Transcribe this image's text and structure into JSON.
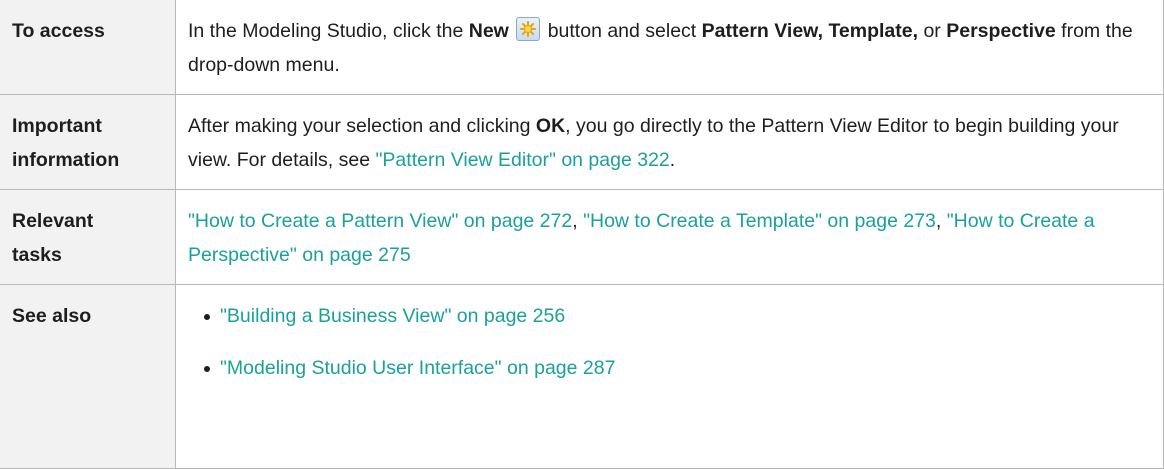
{
  "rows": {
    "access": {
      "label": "To access",
      "t1": "In the Modeling Studio, click the ",
      "b1": "New",
      "t2": " button and select ",
      "b2": "Pattern View, Template,",
      "t3": " or ",
      "b3": "Perspective",
      "t4": " from the drop-down menu."
    },
    "important": {
      "label1": "Important",
      "label2": "information",
      "t1": "After making your selection and clicking ",
      "b1": "OK",
      "t2": ", you go directly to the Pattern View Editor to begin building your view. For details, see ",
      "link1": "\"Pattern View Editor\" on page 322",
      "t3": "."
    },
    "tasks": {
      "label1": "Relevant",
      "label2": "tasks",
      "link1": "\"How to Create a Pattern View\" on page 272",
      "sep1": ", ",
      "link2": "\"How to Create a Template\" on page 273",
      "sep2": ", ",
      "link3": "\"How to Create a Perspective\" on page 275"
    },
    "see_also": {
      "label": "See also",
      "items": [
        "\"Building a Business View\" on page 256",
        "\"Modeling Studio User Interface\" on page 287"
      ]
    }
  },
  "icons": {
    "new_button": "new-star-icon"
  },
  "colors": {
    "link": "#1aa19c",
    "label_bg": "#f2f2f2",
    "border": "#b9b9b9"
  }
}
